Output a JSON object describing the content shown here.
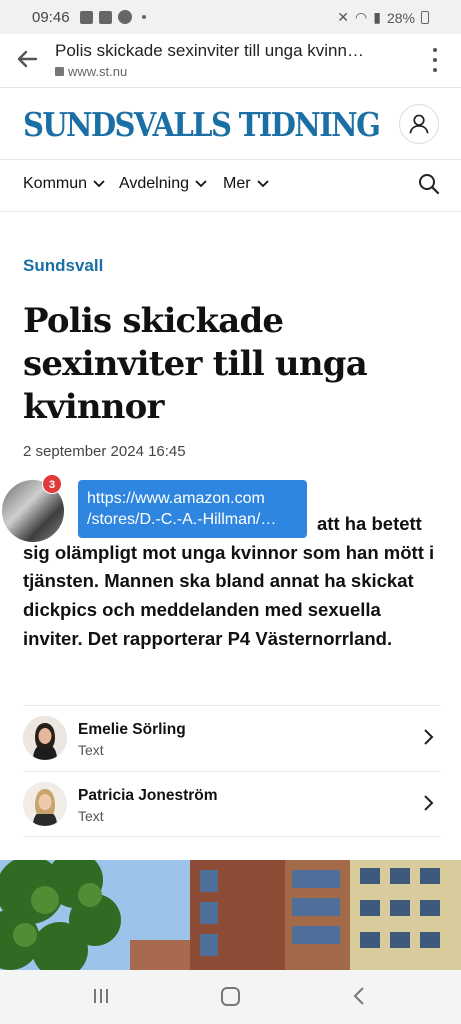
{
  "status_bar": {
    "time": "09:46",
    "battery": "28%"
  },
  "browser": {
    "page_title": "Polis skickade sexinviter till unga kvinn…",
    "url": "www.st.nu"
  },
  "site": {
    "logo_text": "SUNDSVALLS TIDNING"
  },
  "nav": {
    "items": [
      {
        "label": "Kommun"
      },
      {
        "label": "Avdelning"
      },
      {
        "label": "Mer"
      }
    ]
  },
  "article": {
    "section": "Sundsvall",
    "headline": "Polis skickade sexinviter till unga kvinnor",
    "date": "2 september 2024 16:45",
    "lead_visible_1": "",
    "lead_visible_2": "att ha betett",
    "lead_rest": "sig olämpligt mot unga kvinnor som han mött i tjänsten. Mannen ska bland annat ha skickat dickpics och meddelanden med sexuella inviter. Det rapporterar P4 Västernorrland."
  },
  "chat_head": {
    "badge_count": "3"
  },
  "tooltip": {
    "line1": "https://www.amazon.com",
    "line2": "/stores/D.-C.-A.-Hillman/…"
  },
  "authors": [
    {
      "name": "Emelie Sörling",
      "role": "Text"
    },
    {
      "name": "Patricia Joneström",
      "role": "Text"
    }
  ]
}
